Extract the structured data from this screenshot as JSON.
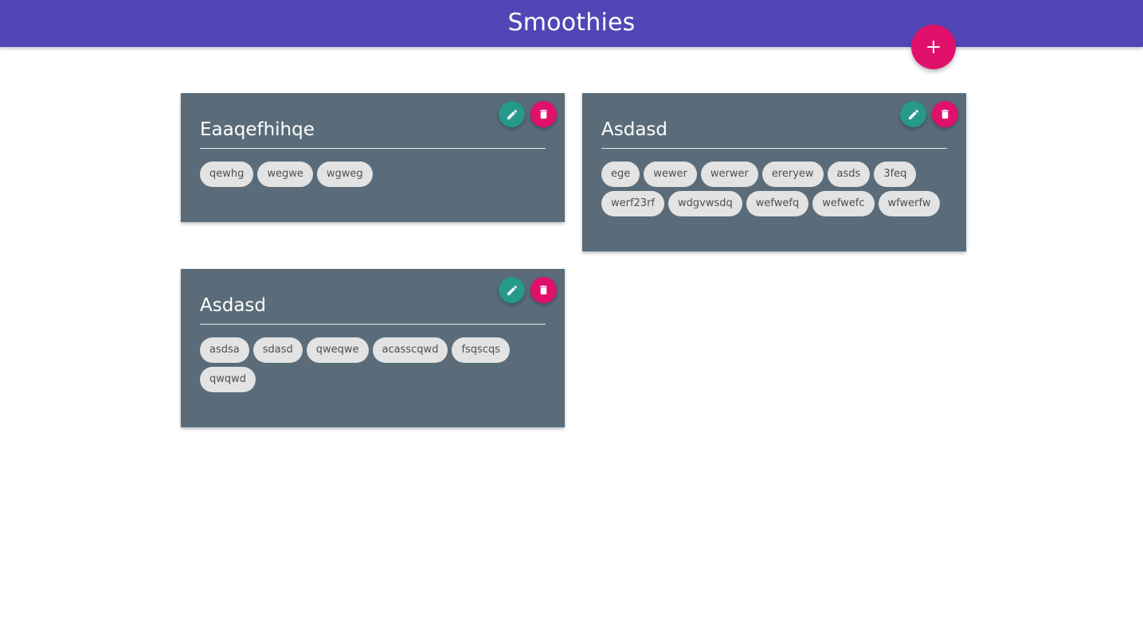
{
  "header": {
    "title": "Smoothies",
    "background_color": "#5246b6"
  },
  "fab": {
    "icon": "plus-icon",
    "color": "#e0106b"
  },
  "card_style": {
    "background_color": "#5a6c79",
    "edit_button_color": "#26998a",
    "delete_button_color": "#e0106b",
    "edit_icon": "pencil-icon",
    "delete_icon": "trash-icon"
  },
  "smoothies": [
    {
      "title": "Eaaqefhihqe",
      "ingredients": [
        "qewhg",
        "wegwe",
        "wgweg"
      ]
    },
    {
      "title": "Asdasd",
      "ingredients": [
        "ege",
        "wewer",
        "werwer",
        "ereryew",
        "asds",
        "3feq",
        "werf23rf",
        "wdgvwsdq",
        "wefwefq",
        "wefwefc",
        "wfwerfw"
      ]
    },
    {
      "title": "Asdasd",
      "ingredients": [
        "asdsa",
        "sdasd",
        "qweqwe",
        "acasscqwd",
        "fsqscqs",
        "qwqwd"
      ]
    }
  ]
}
